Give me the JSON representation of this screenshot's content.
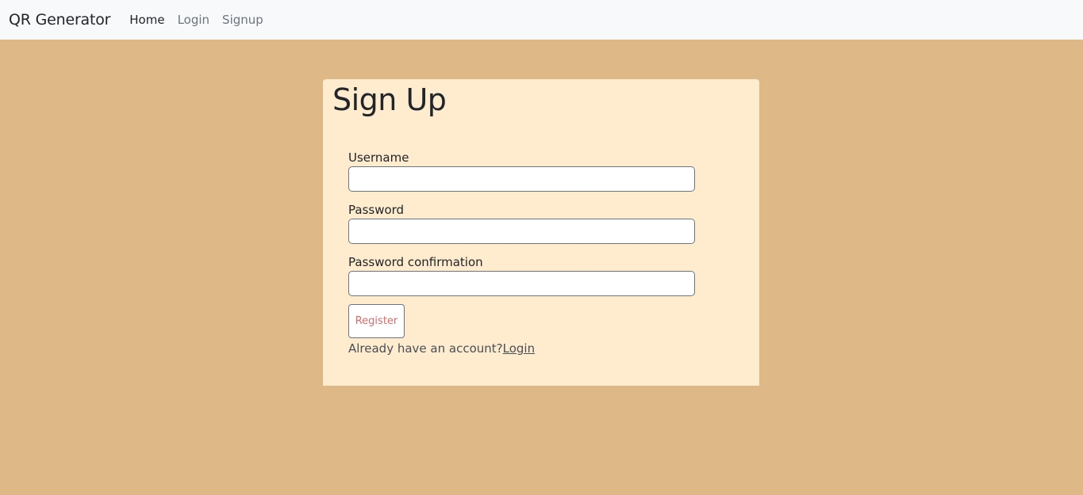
{
  "navbar": {
    "brand": "QR Generator",
    "links": [
      {
        "label": "Home",
        "active": true
      },
      {
        "label": "Login",
        "active": false
      },
      {
        "label": "Signup",
        "active": false
      }
    ]
  },
  "form": {
    "title": "Sign Up",
    "fields": [
      {
        "label": "Username",
        "value": ""
      },
      {
        "label": "Password",
        "value": ""
      },
      {
        "label": "Password confirmation",
        "value": ""
      }
    ],
    "submit_label": "Register",
    "account_prompt": "Already have an account?",
    "login_link": "Login"
  },
  "colors": {
    "page_background": "#deb887",
    "card_background": "#ffebcd",
    "navbar_background": "#f8f9fa",
    "button_text": "#dc6a6a"
  }
}
